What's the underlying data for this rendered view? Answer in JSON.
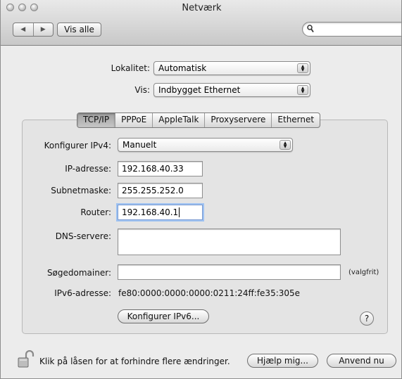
{
  "window": {
    "title": "Netværk"
  },
  "toolbar": {
    "back_forward": [
      "◀",
      "▶"
    ],
    "show_all_label": "Vis alle",
    "search_placeholder": ""
  },
  "location": {
    "label": "Lokalitet:",
    "value": "Automatisk"
  },
  "show": {
    "label": "Vis:",
    "value": "Indbygget Ethernet"
  },
  "tabs": [
    {
      "label": "TCP/IP",
      "selected": true
    },
    {
      "label": "PPPoE",
      "selected": false
    },
    {
      "label": "AppleTalk",
      "selected": false
    },
    {
      "label": "Proxyservere",
      "selected": false
    },
    {
      "label": "Ethernet",
      "selected": false
    }
  ],
  "tcpip": {
    "configure_ipv4": {
      "label": "Konfigurer IPv4:",
      "value": "Manuelt"
    },
    "ip_address": {
      "label": "IP-adresse:",
      "value": "192.168.40.33"
    },
    "subnet_mask": {
      "label": "Subnetmaske:",
      "value": "255.255.252.0"
    },
    "router": {
      "label": "Router:",
      "value": "192.168.40.1"
    },
    "dns_servers": {
      "label": "DNS-servere:",
      "value": ""
    },
    "search_domains": {
      "label": "Søgedomainer:",
      "value": "",
      "optional": "(valgfrit)"
    },
    "ipv6_address": {
      "label": "IPv6-adresse:",
      "value": "fe80:0000:0000:0000:0211:24ff:fe35:305e"
    },
    "configure_ipv6_button": "Konfigurer IPv6...",
    "help_symbol": "?"
  },
  "footer": {
    "lock_text": "Klik på låsen for at forhindre flere ændringer.",
    "help_button": "Hjælp mig...",
    "apply_button": "Anvend nu"
  }
}
